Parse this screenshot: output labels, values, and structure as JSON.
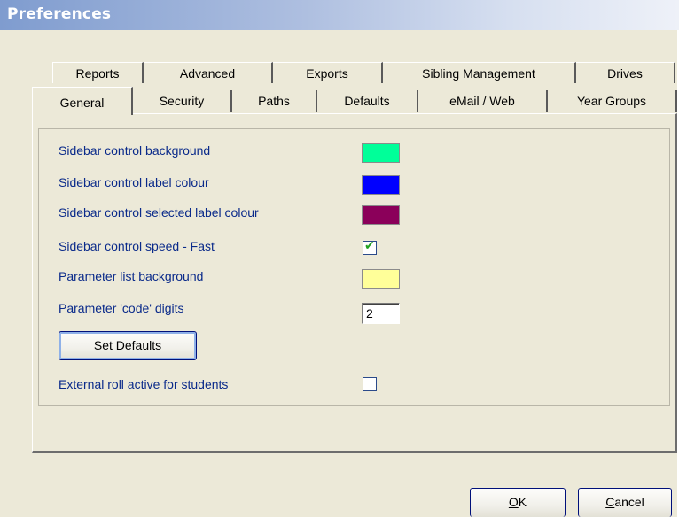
{
  "window": {
    "title": "Preferences"
  },
  "tabs": {
    "back_row": [
      {
        "label": "Reports"
      },
      {
        "label": "Advanced"
      },
      {
        "label": "Exports"
      },
      {
        "label": "Sibling Management"
      },
      {
        "label": "Drives"
      }
    ],
    "front_row": [
      {
        "label": "General",
        "active": true
      },
      {
        "label": "Security"
      },
      {
        "label": "Paths"
      },
      {
        "label": "Defaults"
      },
      {
        "label": "eMail / Web"
      },
      {
        "label": "Year Groups"
      }
    ]
  },
  "general": {
    "options": [
      {
        "label": "Sidebar control background",
        "kind": "color",
        "color": "#00ff99"
      },
      {
        "label": "Sidebar control label colour",
        "kind": "color",
        "color": "#0000ff"
      },
      {
        "label": "Sidebar control selected label colour",
        "kind": "color",
        "color": "#8b005a"
      },
      {
        "label": "Sidebar control speed - Fast",
        "kind": "checkbox",
        "checked": true
      },
      {
        "label": "Parameter list background",
        "kind": "color",
        "color": "#ffff99"
      },
      {
        "label": "Parameter 'code' digits",
        "kind": "number",
        "value": "2"
      }
    ],
    "set_defaults": {
      "mnemonic": "S",
      "rest": "et Defaults"
    },
    "external_roll": {
      "label": "External roll active for students",
      "checked": false
    }
  },
  "footer": {
    "ok": {
      "mnemonic": "O",
      "rest": "K"
    },
    "cancel": {
      "mnemonic": "C",
      "rest": "ancel"
    }
  },
  "icons": {
    "check": "check-icon"
  }
}
